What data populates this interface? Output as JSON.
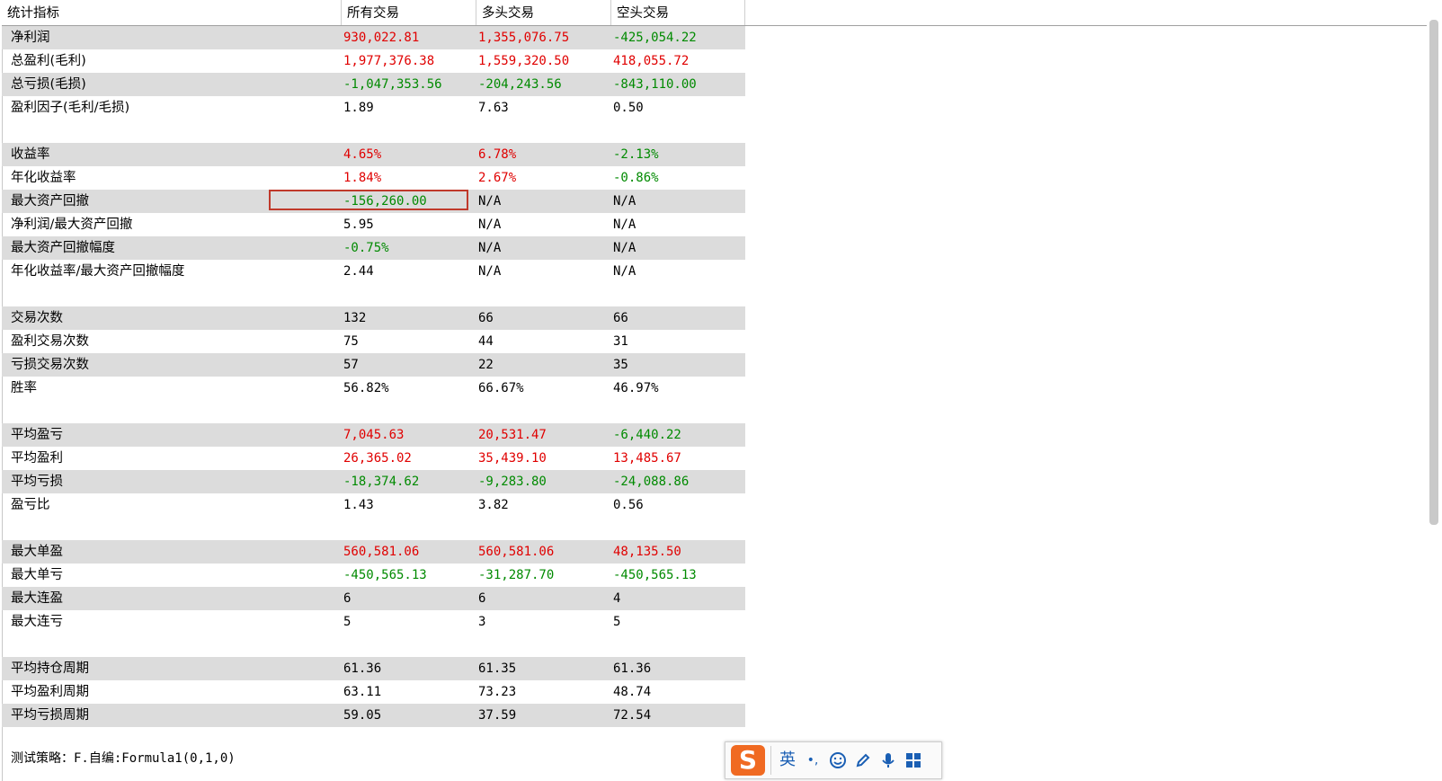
{
  "header": {
    "col0": "统计指标",
    "col1": "所有交易",
    "col2": "多头交易",
    "col3": "空头交易"
  },
  "rows": [
    {
      "label": "净利润",
      "all": "930,022.81",
      "long": "1,355,076.75",
      "short": "-425,054.22",
      "colors": [
        "red",
        "red",
        "green"
      ]
    },
    {
      "label": "总盈利(毛利)",
      "all": "1,977,376.38",
      "long": "1,559,320.50",
      "short": "418,055.72",
      "colors": [
        "red",
        "red",
        "red"
      ]
    },
    {
      "label": "总亏损(毛损)",
      "all": "-1,047,353.56",
      "long": "-204,243.56",
      "short": "-843,110.00",
      "colors": [
        "green",
        "green",
        "green"
      ]
    },
    {
      "label": "盈利因子(毛利/毛损)",
      "all": "1.89",
      "long": "7.63",
      "short": "0.50",
      "colors": [
        "black",
        "black",
        "black"
      ]
    },
    {
      "blank": true
    },
    {
      "label": "收益率",
      "all": "4.65%",
      "long": "6.78%",
      "short": "-2.13%",
      "colors": [
        "red",
        "red",
        "green"
      ]
    },
    {
      "label": "年化收益率",
      "all": "1.84%",
      "long": "2.67%",
      "short": "-0.86%",
      "colors": [
        "red",
        "red",
        "green"
      ]
    },
    {
      "label": "最大资产回撤",
      "all": "-156,260.00",
      "long": "N/A",
      "short": "N/A",
      "colors": [
        "green",
        "black",
        "black"
      ]
    },
    {
      "label": "净利润/最大资产回撤",
      "all": "5.95",
      "long": "N/A",
      "short": "N/A",
      "colors": [
        "black",
        "black",
        "black"
      ]
    },
    {
      "label": "最大资产回撤幅度",
      "all": "-0.75%",
      "long": "N/A",
      "short": "N/A",
      "colors": [
        "green",
        "black",
        "black"
      ]
    },
    {
      "label": "年化收益率/最大资产回撤幅度",
      "all": "2.44",
      "long": "N/A",
      "short": "N/A",
      "colors": [
        "black",
        "black",
        "black"
      ]
    },
    {
      "blank": true
    },
    {
      "label": "交易次数",
      "all": "132",
      "long": "66",
      "short": "66",
      "colors": [
        "black",
        "black",
        "black"
      ]
    },
    {
      "label": "盈利交易次数",
      "all": "75",
      "long": "44",
      "short": "31",
      "colors": [
        "black",
        "black",
        "black"
      ]
    },
    {
      "label": "亏损交易次数",
      "all": "57",
      "long": "22",
      "short": "35",
      "colors": [
        "black",
        "black",
        "black"
      ]
    },
    {
      "label": "胜率",
      "all": "56.82%",
      "long": "66.67%",
      "short": "46.97%",
      "colors": [
        "black",
        "black",
        "black"
      ]
    },
    {
      "blank": true
    },
    {
      "label": "平均盈亏",
      "all": "7,045.63",
      "long": "20,531.47",
      "short": "-6,440.22",
      "colors": [
        "red",
        "red",
        "green"
      ]
    },
    {
      "label": "平均盈利",
      "all": "26,365.02",
      "long": "35,439.10",
      "short": "13,485.67",
      "colors": [
        "red",
        "red",
        "red"
      ]
    },
    {
      "label": "平均亏损",
      "all": "-18,374.62",
      "long": "-9,283.80",
      "short": "-24,088.86",
      "colors": [
        "green",
        "green",
        "green"
      ]
    },
    {
      "label": "盈亏比",
      "all": "1.43",
      "long": "3.82",
      "short": "0.56",
      "colors": [
        "black",
        "black",
        "black"
      ]
    },
    {
      "blank": true
    },
    {
      "label": "最大单盈",
      "all": "560,581.06",
      "long": "560,581.06",
      "short": "48,135.50",
      "colors": [
        "red",
        "red",
        "red"
      ]
    },
    {
      "label": "最大单亏",
      "all": "-450,565.13",
      "long": "-31,287.70",
      "short": "-450,565.13",
      "colors": [
        "green",
        "green",
        "green"
      ]
    },
    {
      "label": "最大连盈",
      "all": "6",
      "long": "6",
      "short": "4",
      "colors": [
        "black",
        "black",
        "black"
      ]
    },
    {
      "label": "最大连亏",
      "all": "5",
      "long": "3",
      "short": "5",
      "colors": [
        "black",
        "black",
        "black"
      ]
    },
    {
      "blank": true
    },
    {
      "label": "平均持仓周期",
      "all": "61.36",
      "long": "61.35",
      "short": "61.36",
      "colors": [
        "black",
        "black",
        "black"
      ]
    },
    {
      "label": "平均盈利周期",
      "all": "63.11",
      "long": "73.23",
      "short": "48.74",
      "colors": [
        "black",
        "black",
        "black"
      ]
    },
    {
      "label": "平均亏损周期",
      "all": "59.05",
      "long": "37.59",
      "short": "72.54",
      "colors": [
        "black",
        "black",
        "black"
      ]
    }
  ],
  "footer": {
    "strategy": "测试策略：F.自编:Formula1(0,1,0)"
  },
  "ime": {
    "logo": "S",
    "lang": "英",
    "punct": "•,",
    "icons": [
      "emoji-icon",
      "pen-icon",
      "mic-icon",
      "grid-icon"
    ]
  }
}
